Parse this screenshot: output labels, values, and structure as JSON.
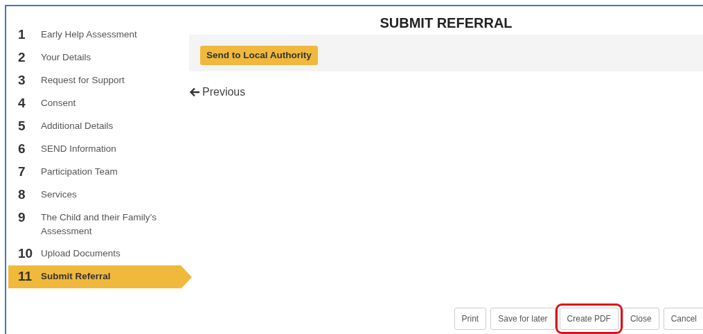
{
  "steps": [
    {
      "number": "1",
      "label": "Early Help Assessment",
      "selected": false
    },
    {
      "number": "2",
      "label": "Your Details",
      "selected": false
    },
    {
      "number": "3",
      "label": "Request for Support",
      "selected": false
    },
    {
      "number": "4",
      "label": "Consent",
      "selected": false
    },
    {
      "number": "5",
      "label": "Additional Details",
      "selected": false
    },
    {
      "number": "6",
      "label": "SEND Information",
      "selected": false
    },
    {
      "number": "7",
      "label": "Participation Team",
      "selected": false
    },
    {
      "number": "8",
      "label": "Services",
      "selected": false
    },
    {
      "number": "9",
      "label": "The Child and their Family’s Assessment",
      "selected": false
    },
    {
      "number": "10",
      "label": "Upload Documents",
      "selected": false
    },
    {
      "number": "11",
      "label": "Submit Referral",
      "selected": true
    }
  ],
  "title": "SUBMIT REFERRAL",
  "send_button": "Send to Local Authority",
  "previous_link": "Previous",
  "footer_buttons": [
    {
      "label": "Print",
      "highlighted": false
    },
    {
      "label": "Save for later",
      "highlighted": false
    },
    {
      "label": "Create PDF",
      "highlighted": true
    },
    {
      "label": "Close",
      "highlighted": false
    },
    {
      "label": "Cancel",
      "highlighted": false
    }
  ]
}
